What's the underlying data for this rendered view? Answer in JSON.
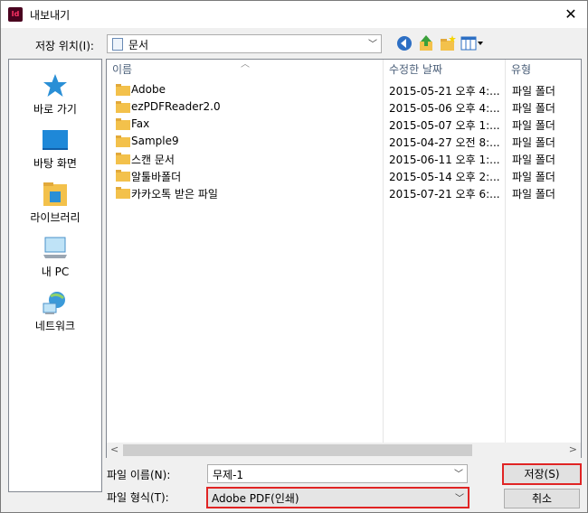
{
  "window": {
    "title": "내보내기",
    "app_icon_text": "Id",
    "close_glyph": "✕"
  },
  "save_in": {
    "label": "저장 위치(I):",
    "value": "문서"
  },
  "places": [
    {
      "label": "바로 가기",
      "icon": "star-icon"
    },
    {
      "label": "바탕 화면",
      "icon": "desktop-icon"
    },
    {
      "label": "라이브러리",
      "icon": "library-icon"
    },
    {
      "label": "내 PC",
      "icon": "computer-icon"
    },
    {
      "label": "네트워크",
      "icon": "network-icon"
    }
  ],
  "columns": {
    "name": "이름",
    "date": "수정한 날짜",
    "type": "유형"
  },
  "files": [
    {
      "name": "Adobe",
      "date": "2015-05-21 오후 4:...",
      "type": "파일 폴더"
    },
    {
      "name": "ezPDFReader2.0",
      "date": "2015-05-06 오후 4:...",
      "type": "파일 폴더"
    },
    {
      "name": "Fax",
      "date": "2015-05-07 오후 1:...",
      "type": "파일 폴더"
    },
    {
      "name": "Sample9",
      "date": "2015-04-27 오전 8:...",
      "type": "파일 폴더"
    },
    {
      "name": "스캔 문서",
      "date": "2015-06-11 오후 1:...",
      "type": "파일 폴더"
    },
    {
      "name": "알툴바폴더",
      "date": "2015-05-14 오후 2:...",
      "type": "파일 폴더"
    },
    {
      "name": "카카오톡 받은 파일",
      "date": "2015-07-21 오후 6:...",
      "type": "파일 폴더"
    }
  ],
  "file_name": {
    "label": "파일 이름(N):",
    "value": "무제-1"
  },
  "file_type": {
    "label": "파일 형식(T):",
    "value": "Adobe PDF(인쇄)"
  },
  "buttons": {
    "save": "저장(S)",
    "cancel": "취소"
  },
  "colors": {
    "highlight_border": "#e02424",
    "folder": "#f3c14b"
  }
}
